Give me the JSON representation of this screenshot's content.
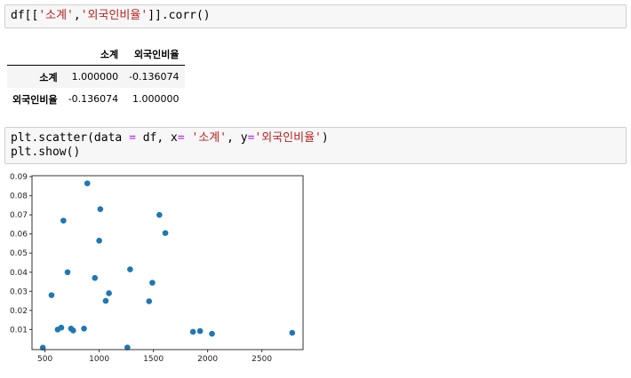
{
  "cells": [
    {
      "tokens": [
        {
          "t": "df[[",
          "c": "tok-name"
        },
        {
          "t": "'소계'",
          "c": "tok-str"
        },
        {
          "t": ",",
          "c": "tok-name"
        },
        {
          "t": "'외국인비율'",
          "c": "tok-str"
        },
        {
          "t": "]].corr()",
          "c": "tok-name"
        }
      ]
    },
    {
      "lines": [
        [
          {
            "t": "plt.scatter(data ",
            "c": "tok-name"
          },
          {
            "t": "=",
            "c": "tok-op"
          },
          {
            "t": " df, x",
            "c": "tok-name"
          },
          {
            "t": "=",
            "c": "tok-op"
          },
          {
            "t": " ",
            "c": "tok-name"
          },
          {
            "t": "'소계'",
            "c": "tok-str"
          },
          {
            "t": ", y",
            "c": "tok-name"
          },
          {
            "t": "=",
            "c": "tok-op"
          },
          {
            "t": "'외국인비율'",
            "c": "tok-str"
          },
          {
            "t": ")",
            "c": "tok-name"
          }
        ],
        [
          {
            "t": "plt.show()",
            "c": "tok-name"
          }
        ]
      ]
    }
  ],
  "corr_table": {
    "columns": [
      "소계",
      "외국인비율"
    ],
    "rows": [
      {
        "index": "소계",
        "values": [
          "1.000000",
          "-0.136074"
        ]
      },
      {
        "index": "외국인비율",
        "values": [
          "-0.136074",
          "1.000000"
        ]
      }
    ]
  },
  "chart_data": {
    "type": "scatter",
    "title": "",
    "xlabel": "",
    "ylabel": "",
    "xlim": [
      380,
      2880
    ],
    "ylim": [
      -0.0005,
      0.0905
    ],
    "xticks": [
      500,
      1000,
      1500,
      2000,
      2500
    ],
    "yticks": [
      0.01,
      0.02,
      0.03,
      0.04,
      0.05,
      0.06,
      0.07,
      0.08,
      0.09
    ],
    "xtick_labels": [
      "500",
      "1000",
      "1500",
      "2000",
      "2500"
    ],
    "ytick_labels": [
      "0.01",
      "0.02",
      "0.03",
      "0.04",
      "0.05",
      "0.06",
      "0.07",
      "0.08",
      "0.09"
    ],
    "grid": false,
    "color": "#1f77b4",
    "x": [
      480,
      560,
      617,
      650,
      670,
      708,
      740,
      760,
      860,
      890,
      960,
      1000,
      1010,
      1060,
      1090,
      1260,
      1285,
      1460,
      1490,
      1555,
      1610,
      1865,
      1930,
      2040,
      2780
    ],
    "y": [
      0.0005,
      0.028,
      0.01,
      0.011,
      0.067,
      0.04,
      0.0105,
      0.0095,
      0.0105,
      0.0865,
      0.037,
      0.0565,
      0.073,
      0.025,
      0.029,
      0.0006,
      0.0415,
      0.0248,
      0.0345,
      0.07,
      0.0605,
      0.0088,
      0.0092,
      0.0078,
      0.0083
    ]
  }
}
